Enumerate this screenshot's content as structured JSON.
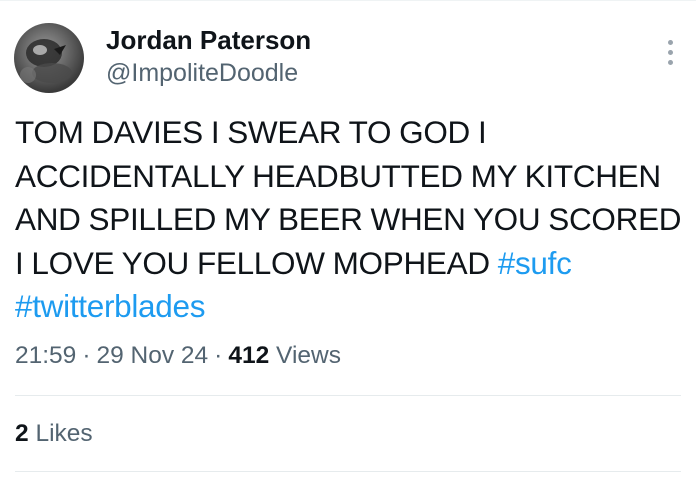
{
  "author": {
    "display_name": "Jordan Paterson",
    "handle": "@ImpoliteDoodle"
  },
  "tweet": {
    "text_lines": [
      "TOM DAVIES I SWEAR TO GOD I",
      "ACCIDENTALLY HEADBUTTED MY KITCHEN",
      "AND SPILLED MY BEER WHEN YOU SCORED",
      "I LOVE YOU FELLOW MOPHEAD "
    ],
    "hashtags": [
      "#sufc",
      "#twitterblades"
    ]
  },
  "meta": {
    "time": "21:59",
    "separator": "·",
    "date": "29 Nov 24",
    "views_count": "412",
    "views_label": "Views"
  },
  "engagement": {
    "likes_count": "2",
    "likes_label": "Likes"
  },
  "icons": {
    "more": "more-options-icon"
  },
  "colors": {
    "text": "#0f1419",
    "secondary": "#536471",
    "link": "#1d9bf0",
    "divider": "#e6ebed"
  }
}
